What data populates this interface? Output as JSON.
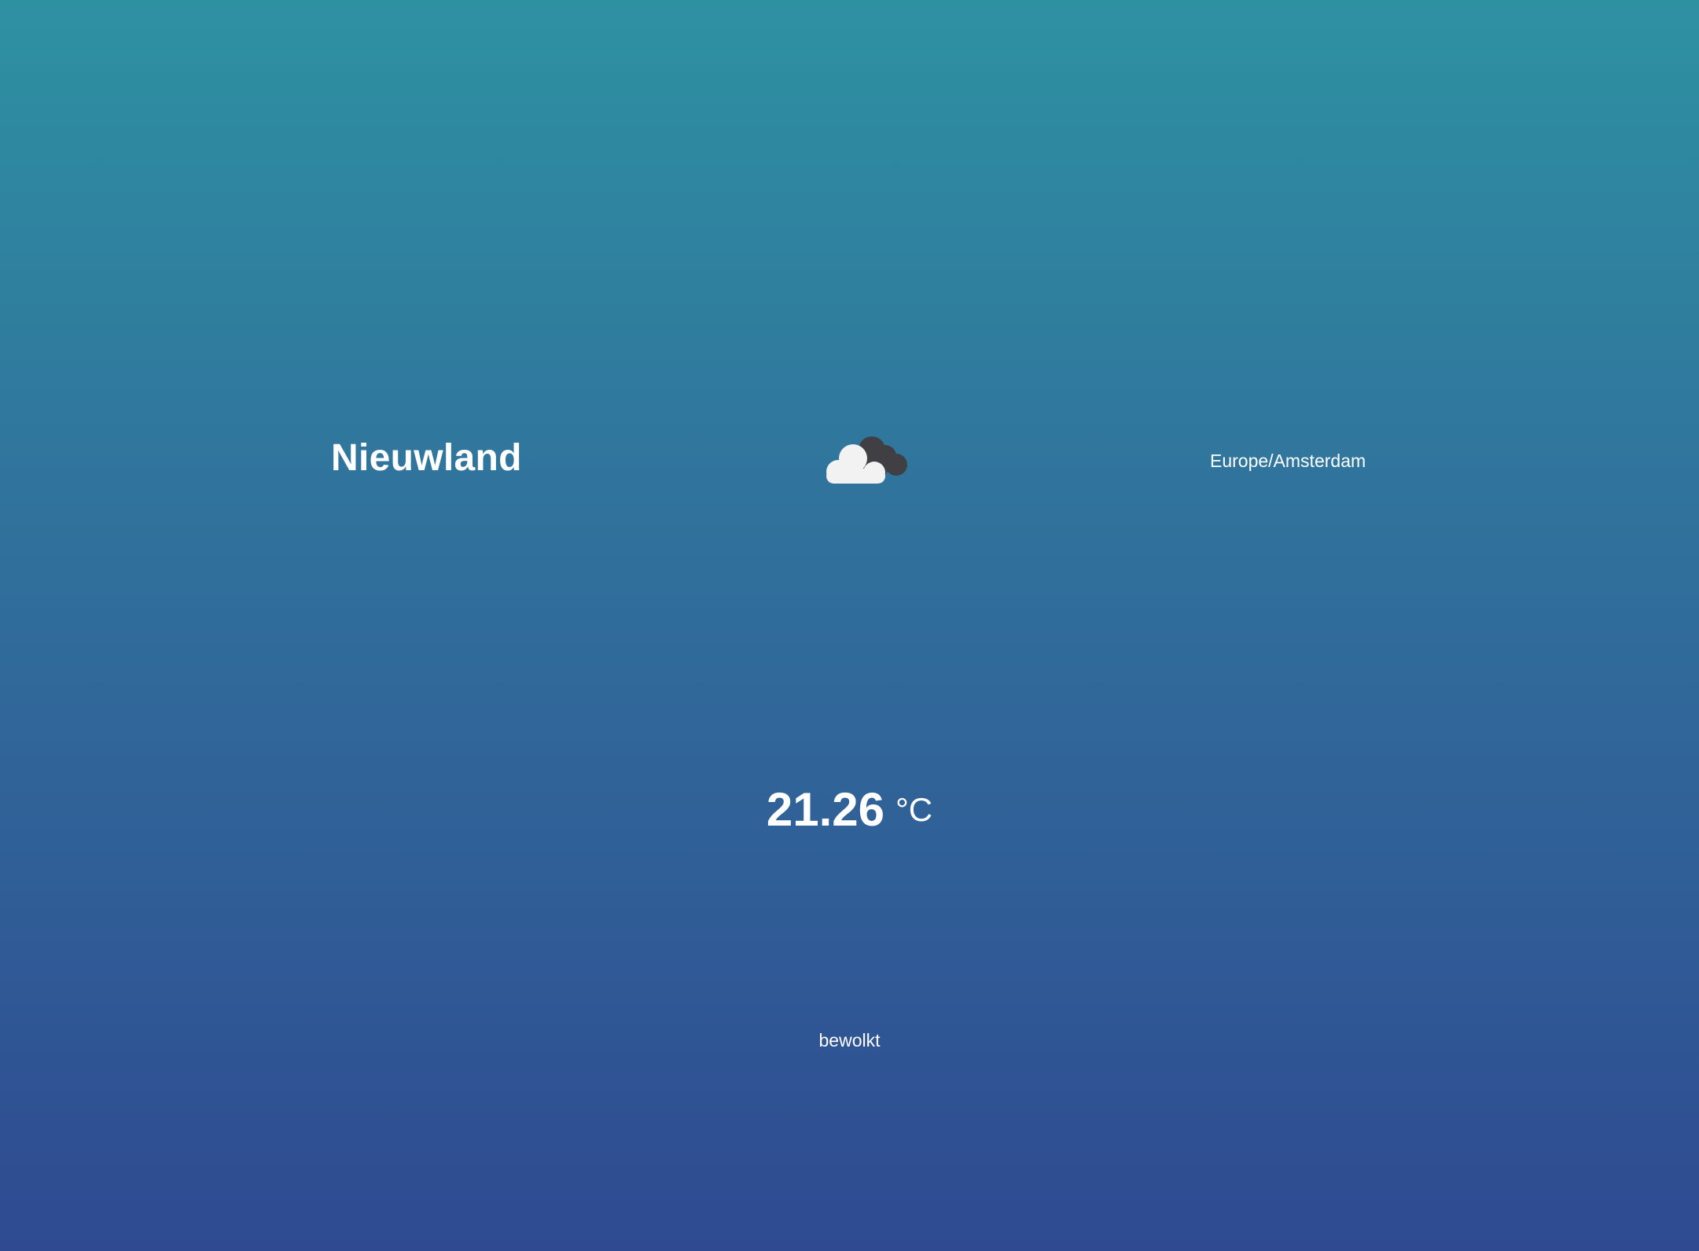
{
  "location": {
    "city": "Nieuwland",
    "timezone": "Europe/Amsterdam"
  },
  "weather": {
    "icon": "cloudy-icon",
    "temperature": "21.26",
    "unit": "°C",
    "description": "bewolkt"
  },
  "colors": {
    "background_top": "#2e91a2",
    "background_bottom": "#2f4a91",
    "text": "#ffffff",
    "cloud_front": "#f2f2f2",
    "cloud_back": "#3f3f44"
  }
}
